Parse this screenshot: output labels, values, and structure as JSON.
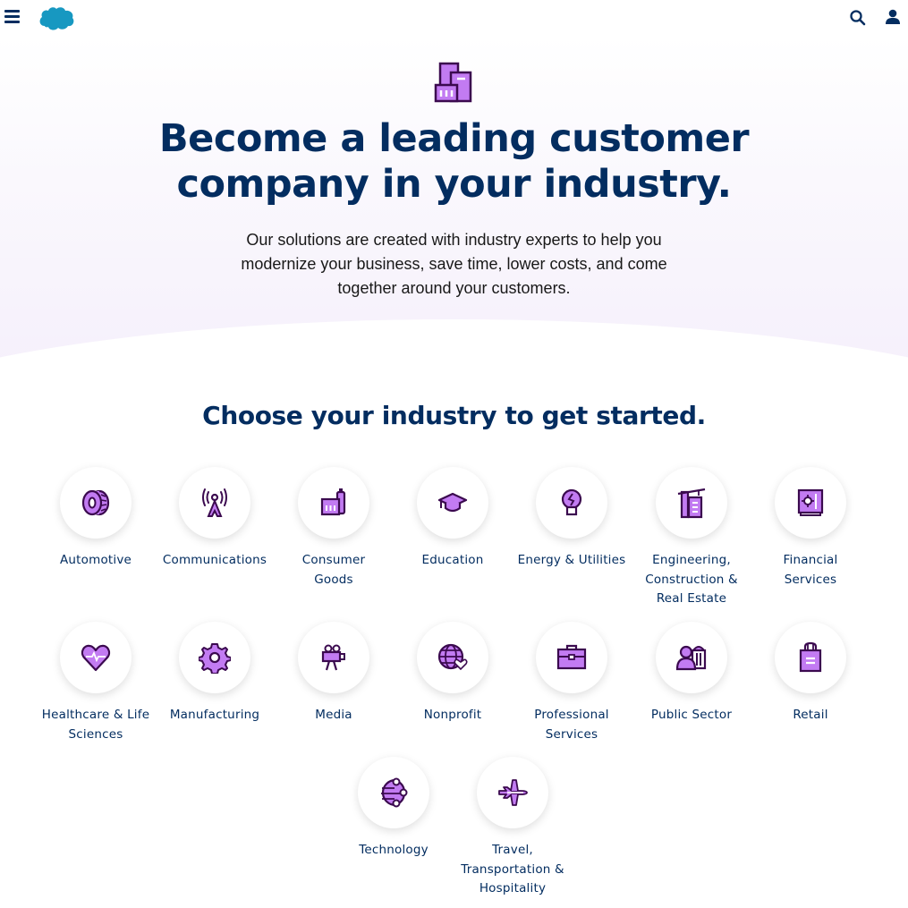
{
  "header": {
    "menu_icon": "hamburger-menu-icon",
    "logo": "cloud-logo",
    "logo_color": "#1798c1",
    "search_icon": "search-icon",
    "user_icon": "user-icon"
  },
  "hero": {
    "icon": "buildings-icon",
    "title_line1": "Become a leading customer",
    "title_line2": "company in your industry.",
    "subtitle_line1": "Our solutions are created with industry experts to help you",
    "subtitle_line2": "modernize your business, save time, lower costs, and come",
    "subtitle_line3": "together around your customers."
  },
  "industries": {
    "title": "Choose your industry to get started.",
    "accent_color": "#c27bf2",
    "outline_color": "#3b0a4f",
    "items": [
      {
        "label_lines": [
          "Automotive"
        ],
        "icon": "tire-icon"
      },
      {
        "label_lines": [
          "Communications"
        ],
        "icon": "radio-tower-icon"
      },
      {
        "label_lines": [
          "Consumer",
          "Goods"
        ],
        "icon": "consumer-goods-icon"
      },
      {
        "label_lines": [
          "Education"
        ],
        "icon": "graduation-cap-icon"
      },
      {
        "label_lines": [
          "Energy & Utilities"
        ],
        "icon": "lightbulb-icon"
      },
      {
        "label_lines": [
          "Engineering,",
          "Construction &",
          "Real Estate"
        ],
        "icon": "crane-building-icon"
      },
      {
        "label_lines": [
          "Financial",
          "Services"
        ],
        "icon": "safe-icon"
      },
      {
        "label_lines": [
          "Healthcare & Life",
          "Sciences"
        ],
        "icon": "heart-pulse-icon"
      },
      {
        "label_lines": [
          "Manufacturing"
        ],
        "icon": "gear-icon"
      },
      {
        "label_lines": [
          "Media"
        ],
        "icon": "video-camera-icon"
      },
      {
        "label_lines": [
          "Nonprofit"
        ],
        "icon": "globe-heart-icon"
      },
      {
        "label_lines": [
          "Professional",
          "Services"
        ],
        "icon": "briefcase-icon"
      },
      {
        "label_lines": [
          "Public Sector"
        ],
        "icon": "person-government-icon"
      },
      {
        "label_lines": [
          "Retail"
        ],
        "icon": "shopping-bag-icon"
      },
      {
        "label_lines": [
          "Technology"
        ],
        "icon": "network-globe-icon"
      },
      {
        "label_lines": [
          "Travel,",
          "Transportation &",
          "Hospitality"
        ],
        "icon": "airplane-icon"
      }
    ]
  }
}
